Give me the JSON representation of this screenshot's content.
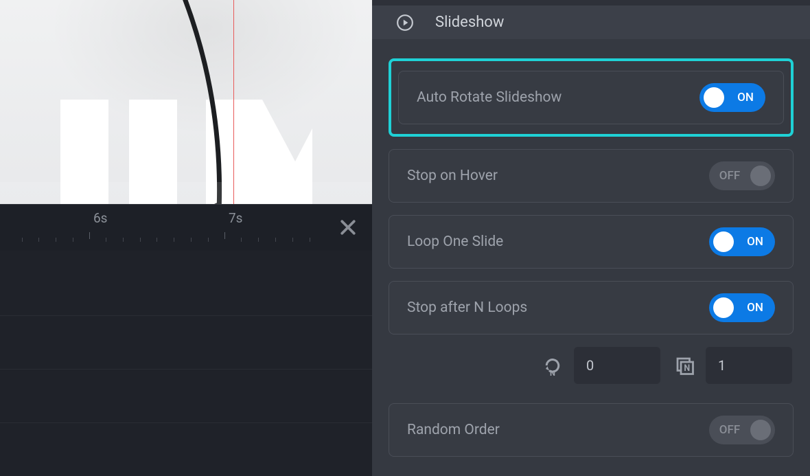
{
  "panel": {
    "title": "Slideshow"
  },
  "settings": {
    "auto_rotate": {
      "label": "Auto Rotate Slideshow",
      "state": "ON",
      "on": true
    },
    "stop_hover": {
      "label": "Stop on Hover",
      "state": "OFF",
      "on": false
    },
    "loop_one": {
      "label": "Loop One Slide",
      "state": "ON",
      "on": true
    },
    "stop_n": {
      "label": "Stop after N Loops",
      "state": "ON",
      "on": true
    },
    "random": {
      "label": "Random Order",
      "state": "OFF",
      "on": false
    }
  },
  "numeric": {
    "loops_value": "0",
    "n_value": "1"
  },
  "timeline": {
    "labels": [
      "6s",
      "7s"
    ]
  }
}
